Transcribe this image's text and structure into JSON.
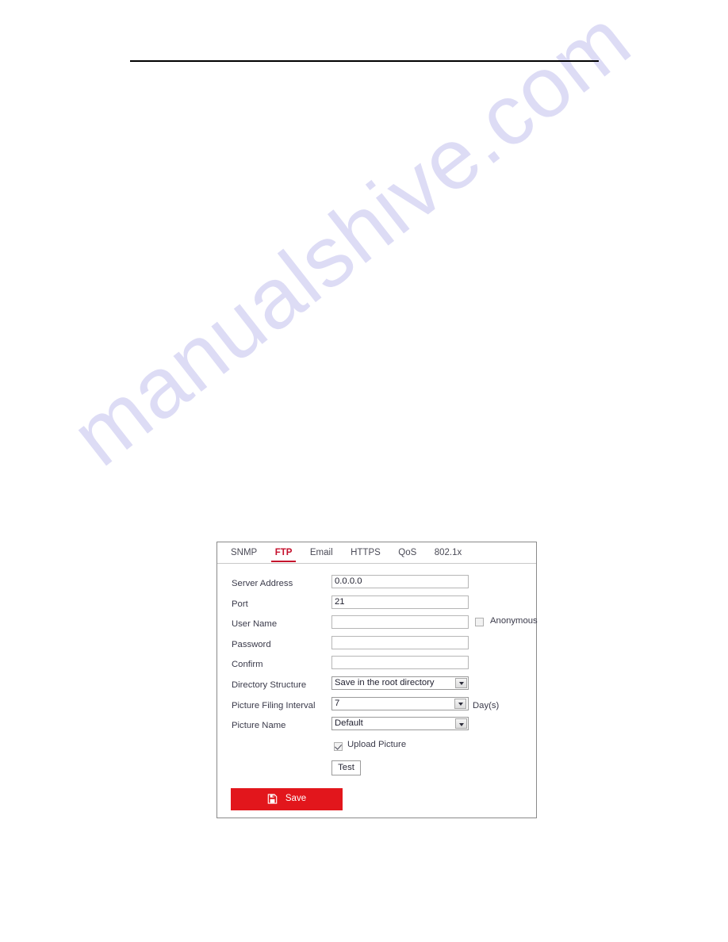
{
  "page": {
    "watermark": "manualshive.com",
    "accent_color": "#c5102c",
    "save_button_color": "#e2161c"
  },
  "panel": {
    "tabs": [
      {
        "label": "SNMP",
        "active": false
      },
      {
        "label": "FTP",
        "active": true
      },
      {
        "label": "Email",
        "active": false
      },
      {
        "label": "HTTPS",
        "active": false
      },
      {
        "label": "QoS",
        "active": false
      },
      {
        "label": "802.1x",
        "active": false
      }
    ],
    "form": {
      "server_address": {
        "label": "Server Address",
        "value": "0.0.0.0"
      },
      "port": {
        "label": "Port",
        "value": "21"
      },
      "user_name": {
        "label": "User Name",
        "value": ""
      },
      "password": {
        "label": "Password",
        "value": ""
      },
      "confirm": {
        "label": "Confirm",
        "value": ""
      },
      "anonymous": {
        "label": "Anonymous",
        "checked": false
      },
      "directory_structure": {
        "label": "Directory Structure",
        "value": "Save in the root directory"
      },
      "picture_filing_interval": {
        "label": "Picture Filing Interval",
        "value": "7",
        "suffix": "Day(s)"
      },
      "picture_name": {
        "label": "Picture Name",
        "value": "Default"
      },
      "upload_picture": {
        "label": "Upload Picture",
        "checked": true
      },
      "test_button": {
        "label": "Test"
      },
      "save_button": {
        "label": "Save"
      }
    }
  }
}
